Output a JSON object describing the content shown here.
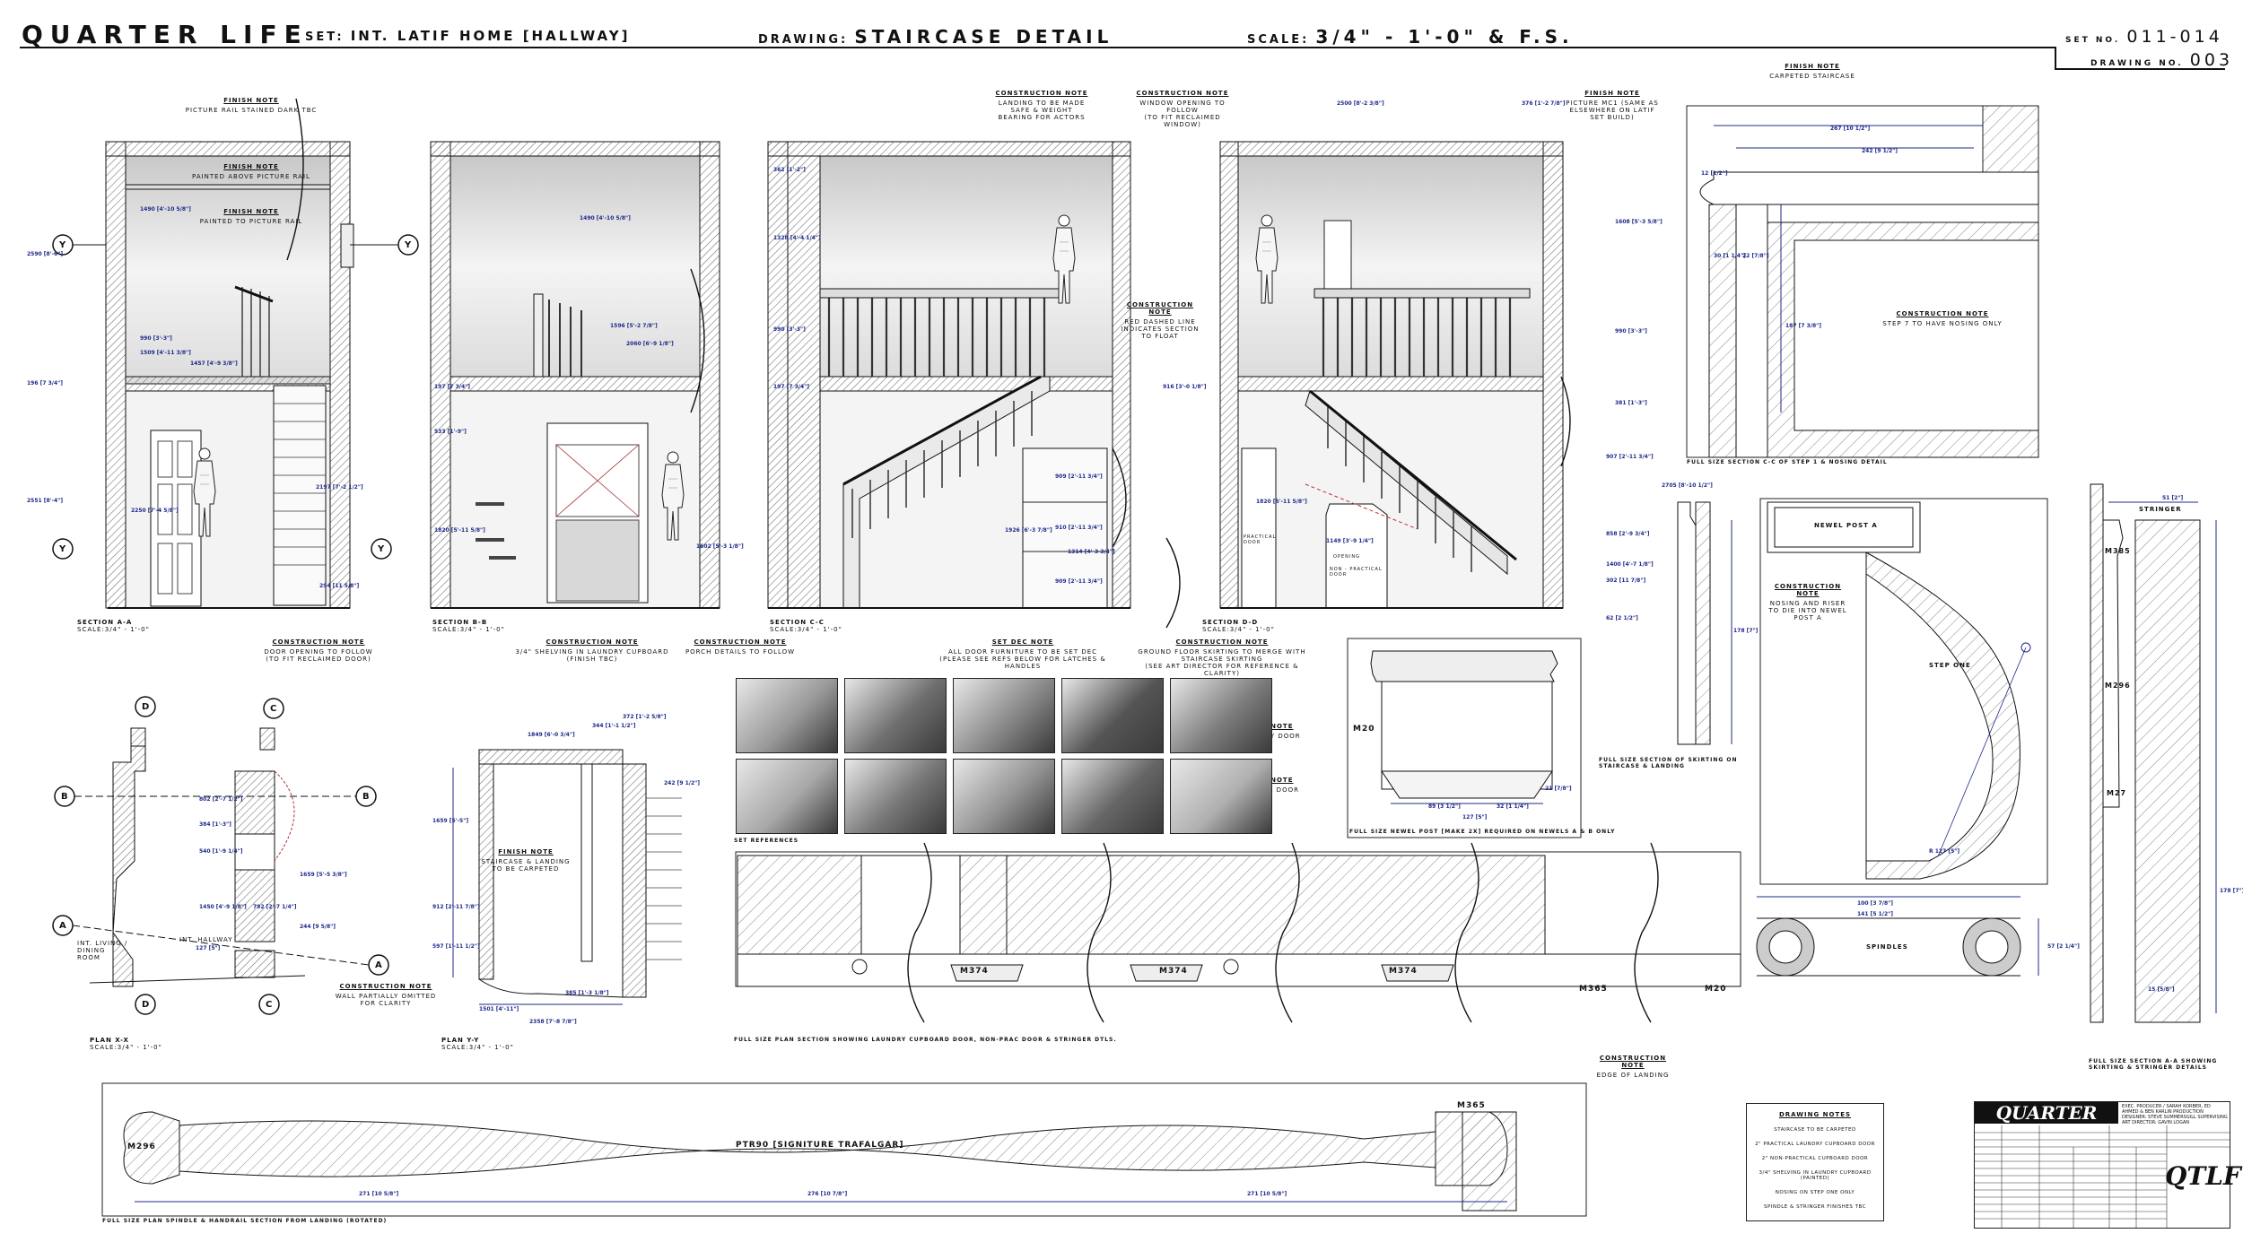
{
  "header": {
    "title": "QUARTER LIFE",
    "set_label": "SET:",
    "set_value": "INT. LATIF HOME [HALLWAY]",
    "drawing_label": "DRAWING:",
    "drawing_value": "STAIRCASE DETAIL",
    "scale_label": "SCALE:",
    "scale_value": "3/4\" - 1'-0\" & F.S.",
    "set_no_label": "SET NO.",
    "set_no_value": "011-014",
    "drawing_no_label": "DRAWING NO.",
    "drawing_no_value": "003"
  },
  "notes": {
    "finish_a": {
      "heading": "FINISH NOTE",
      "text": "PICTURE RAIL STAINED DARK TBC"
    },
    "finish_b": {
      "heading": "FINISH NOTE",
      "text": "PAINTED ABOVE PICTURE RAIL"
    },
    "finish_c": {
      "heading": "FINISH NOTE",
      "text": "PAINTED TO PICTURE RAIL"
    },
    "construction_door": {
      "heading": "CONSTRUCTION NOTE",
      "text": "DOOR OPENING TO FOLLOW",
      "sub": "(TO FIT RECLAIMED DOOR)"
    },
    "construction_shelving": {
      "heading": "CONSTRUCTION NOTE",
      "text": "3/4\" SHELVING IN LAUNDRY CUPBOARD",
      "sub": "(FINISH TBC)"
    },
    "construction_porch": {
      "heading": "CONSTRUCTION NOTE",
      "text": "PORCH DETAILS TO FOLLOW"
    },
    "construction_landing": {
      "heading": "CONSTRUCTION NOTE",
      "text": "LANDING TO BE MADE SAFE & WEIGHT BEARING FOR ACTORS"
    },
    "construction_window": {
      "heading": "CONSTRUCTION NOTE",
      "text": "WINDOW OPENING TO FOLLOW",
      "sub": "(TO FIT RECLAIMED WINDOW)"
    },
    "finish_picture": {
      "heading": "FINISH NOTE",
      "text": "PICTURE MC1 (SAME AS ELSEWHERE ON LATIF SET BUILD)"
    },
    "construction_red_line": {
      "heading": "CONSTRUCTION NOTE",
      "text": "RED DASHED LINE INDICATES SECTION TO FLOAT"
    },
    "set_dec": {
      "heading": "SET DEC NOTE",
      "text": "ALL DOOR FURNITURE TO BE SET DEC (PLEASE SEE REFS BELOW FOR LATCHES & HANDLES"
    },
    "construction_skirting": {
      "heading": "CONSTRUCTION NOTE",
      "text": "GROUND FLOOR SKIRTING TO MERGE WITH STAIRCASE SKIRTING",
      "sub": "(SEE ART DIRECTOR FOR REFERENCE & CLARITY)"
    },
    "finish_carpeted": {
      "heading": "FINISH NOTE",
      "text": "CARPETED STAIRCASE"
    },
    "construction_nosing": {
      "heading": "CONSTRUCTION NOTE",
      "text": "STEP 7 TO HAVE NOSING ONLY"
    },
    "construction_newel": {
      "heading": "CONSTRUCTION NOTE",
      "text": "NOSING AND RISER TO DIE INTO NEWEL POST A"
    },
    "construction_laundry": {
      "heading": "CONSTRUCTION NOTE",
      "text": "PRACTICAL LAUNDRY DOOR"
    },
    "construction_nonprac": {
      "heading": "CONSTRUCTION NOTE",
      "text": "NON-PRAC SMALLER DOOR"
    },
    "finish_staircase": {
      "heading": "FINISH NOTE",
      "text": "STAIRCASE & LANDING TO BE CARPETED"
    },
    "construction_wall": {
      "heading": "CONSTRUCTION NOTE",
      "text": "WALL PARTIALLY OMITTED FOR CLARITY"
    },
    "construction_edge": {
      "heading": "CONSTRUCTION NOTE",
      "text": "EDGE OF LANDING"
    }
  },
  "labels": {
    "section_aa": {
      "title": "SECTION A-A",
      "scale": "SCALE:3/4\" - 1'-0\""
    },
    "section_bb": {
      "title": "SECTION B-B",
      "scale": "SCALE:3/4\" - 1'-0\""
    },
    "section_cc": {
      "title": "SECTION C-C",
      "scale": "SCALE:3/4\" - 1'-0\""
    },
    "section_dd": {
      "title": "SECTION D-D",
      "scale": "SCALE:3/4\" - 1'-0\""
    },
    "plan_xx": {
      "title": "PLAN X-X",
      "scale": "SCALE:3/4\" - 1'-0\""
    },
    "plan_yy": {
      "title": "PLAN Y-Y",
      "scale": "SCALE:3/4\" - 1'-0\""
    },
    "fs_section_cc": "FULL SIZE SECTION C-C OF STEP 1 & NOSING DETAIL",
    "fs_skirting": "FULL SIZE SECTION OF SKIRTING ON STAIRCASE & LANDING",
    "fs_newel": "FULL SIZE NEWEL POST [MAKE 2X] REQUIRED ON NEWELS A & B ONLY",
    "fs_plan_section": "FULL SIZE PLAN SECTION SHOWING LAUNDRY CUPBOARD DOOR, NON-PRAC DOOR & STRINGER DTLS.",
    "fs_section_aa": "FULL SIZE SECTION A-A SHOWING SKIRTING & STRINGER DETAILS",
    "fs_spindle": "FULL SIZE PLAN SPINDLE & HANDRAIL SECTION FROM LANDING (ROTATED)",
    "set_references": "SET REFERENCES",
    "newel_post_a": "NEWEL POST A",
    "step_one": "STEP ONE",
    "spindles": "SPINDLES",
    "stringer": "STRINGER",
    "trafalgar": "PTR90 [SIGNITURE TRAFALGAR]",
    "hallway": "INT. HALLWAY",
    "living_dining": "INT. LIVING / DINING ROOM",
    "practical_door": "PRACTICAL DOOR",
    "non_practical_door": "NON - PRACTICAL DOOR",
    "opening": "OPENING"
  },
  "mouldings": {
    "m374": "M374",
    "m365": "M365",
    "m20": "M20",
    "m296": "M296",
    "m385": "M385",
    "m27": "M27"
  },
  "markers": {
    "y": "Y",
    "a": "A",
    "b": "B",
    "c": "C",
    "d": "D"
  },
  "dimensions": {
    "aa": [
      "2590 [8'-6\"]",
      "2551 [8'-4\"]",
      "1490 [4'-10 5/8\"]",
      "990 [3'-3\"]",
      "1509 [4'-11 3/8\"]",
      "1457 [4'-9 3/8\"]",
      "2197 [7'-2 1/2\"]",
      "2250 [7'-4 5/8\"]",
      "294 [11 5/8\"]",
      "196 [7 3/4\"]"
    ],
    "bb": [
      "1490 [4'-10 5/8\"]",
      "1596 [5'-2 7/8\"]",
      "2060 [6'-9 1/8\"]",
      "197 [7 3/4\"]",
      "533 [1'-9\"]",
      "1820 [5'-11 5/8\"]",
      "1602 [5'-3 1/8\"]"
    ],
    "cc": [
      "362 [1'-2\"]",
      "1328 [4'-4 1/4\"]",
      "990 [3'-3\"]",
      "197 [7 3/4\"]",
      "909 [2'-11 3/4\"]",
      "1926 [6'-3 7/8\"]",
      "910 [2'-11 3/4\"]",
      "1314 [4'-3 3/4\"]",
      "909 [2'-11 3/4\"]",
      "916 [3'-0 1/8\"]"
    ],
    "dd": [
      "2500 [8'-2 3/8\"]",
      "376 [1'-2 7/8\"]",
      "1608 [5'-3 5/8\"]",
      "990 [3'-3\"]",
      "381 [1'-3\"]",
      "907 [2'-11 3/4\"]",
      "2705 [8'-10 1/2\"]",
      "1820 [5'-11 5/8\"]",
      "1149 [3'-9 1/4\"]",
      "1400 [4'-7 1/8\"]",
      "858 [2'-9 3/4\"]",
      "302 [11 7/8\"]",
      "62 [2 1/2\"]"
    ],
    "fs_cc": [
      "267 [10 1/2\"]",
      "242 [9 1/2\"]",
      "187 [7 3/8\"]",
      "12 [1/2\"]",
      "30 [1 1/4\"]",
      "22 [7/8\"]"
    ],
    "plan_xx": [
      "802 [2'-7 1/2\"]",
      "384 [1'-3\"]",
      "540 [1'-9 1/4\"]",
      "1450 [4'-9 1/8\"]",
      "792 [2'-7 1/4\"]",
      "1659 [5'-5 3/8\"]",
      "127 [5\"]",
      "244 [9 5/8\"]"
    ],
    "plan_yy": [
      "1849 [6'-0 3/4\"]",
      "372 [1'-2 5/8\"]",
      "344 [1'-1 1/2\"]",
      "1659 [5'-5\"]",
      "912 [2'-11 7/8\"]",
      "597 [1'-11 1/2\"]",
      "2358 [7'-8 7/8\"]",
      "385 [1'-3 1/8\"]",
      "1501 [4'-11\"]"
    ],
    "newel": [
      "89 [3 1/2\"]",
      "127 [5\"]",
      "32 [1 1/4\"]",
      "21 [7/8\"]"
    ],
    "plan_section": [
      "141 [5 1/2\"]",
      "100 [3 7/8\"]",
      "57 [2 1/4\"]"
    ],
    "fs_aa": [
      "51 [2\"]",
      "178 [7\"]",
      "15 [5/8\"]"
    ],
    "spindle": [
      "271 [10 5/8\"]",
      "276 [10 7/8\"]",
      "271 [10 5/8\"]"
    ],
    "step_one": "R 127 [5\"]",
    "skirting": "178 [7\"]",
    "riser_step": "242 [9 1/2\"]"
  },
  "set_references_count": 10,
  "drawing_notes": {
    "heading": "DRAWING NOTES",
    "lines": [
      "STAIRCASE TO BE CARPETED",
      "2\" PRACTICAL LAUNDRY CUPBOARD DOOR",
      "2\" NON-PRACTICAL CUPBOARD DOOR",
      "3/4\" SHELVING IN LAUNDRY CUPBOARD (PAINTED)",
      "NOSING ON STEP ONE ONLY",
      "SPINDLE & STRINGER FINISHES TBC"
    ]
  },
  "title_block": {
    "banner": "QUARTER LIFE",
    "logo": "QTLF",
    "credits": "EXEC. PRODUCER / SARAH KORBER, ED AHMED & BEN KARLIN PRODUCTION DESIGNER: STEVE SUMMERSGILL SUPERVISING ART DIRECTOR: GAVIN LOGAN"
  },
  "colors": {
    "ink": "#111111",
    "dimension": "#1f2a8a",
    "hatch": "#777777",
    "float_line": "#c03030"
  }
}
